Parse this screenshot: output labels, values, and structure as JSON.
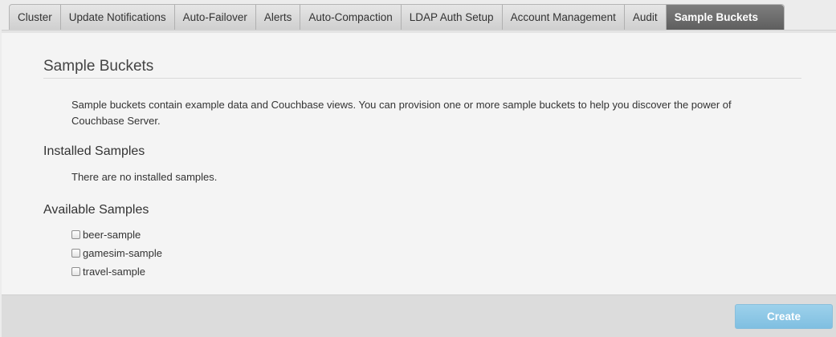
{
  "tabs": [
    {
      "label": "Cluster"
    },
    {
      "label": "Update Notifications"
    },
    {
      "label": "Auto-Failover"
    },
    {
      "label": "Alerts"
    },
    {
      "label": "Auto-Compaction"
    },
    {
      "label": "LDAP Auth Setup"
    },
    {
      "label": "Account Management"
    },
    {
      "label": "Audit"
    },
    {
      "label": "Sample Buckets",
      "active": true
    }
  ],
  "page": {
    "title": "Sample Buckets",
    "intro": "Sample buckets contain example data and Couchbase views. You can provision one or more sample buckets to help you discover the power of Couchbase Server."
  },
  "installed": {
    "heading": "Installed Samples",
    "empty_text": "There are no installed samples."
  },
  "available": {
    "heading": "Available Samples",
    "items": [
      {
        "label": "beer-sample",
        "checked": false
      },
      {
        "label": "gamesim-sample",
        "checked": false
      },
      {
        "label": "travel-sample",
        "checked": false
      }
    ]
  },
  "footer": {
    "create_label": "Create"
  },
  "colors": {
    "active_tab": "#6e6e6e",
    "create_button": "#8cc8e6"
  }
}
